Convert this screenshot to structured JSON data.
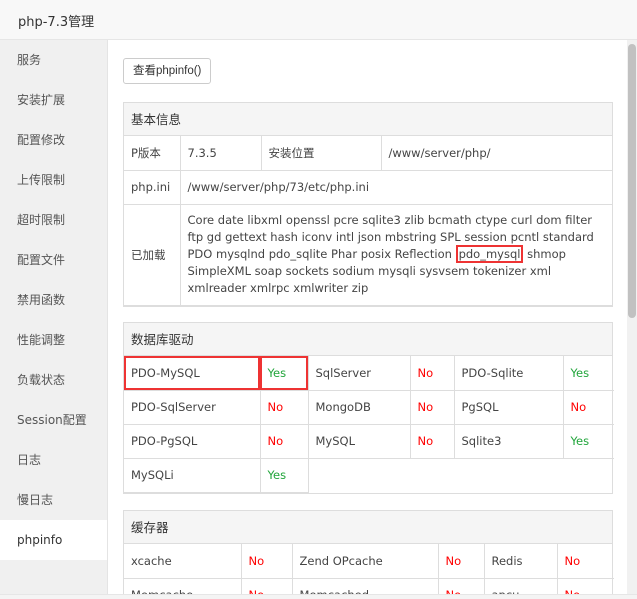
{
  "window": {
    "title": "php-7.3管理"
  },
  "sidebar": {
    "items": [
      {
        "label": "服务"
      },
      {
        "label": "安装扩展"
      },
      {
        "label": "配置修改"
      },
      {
        "label": "上传限制"
      },
      {
        "label": "超时限制"
      },
      {
        "label": "配置文件"
      },
      {
        "label": "禁用函数"
      },
      {
        "label": "性能调整"
      },
      {
        "label": "负载状态"
      },
      {
        "label": "Session配置"
      },
      {
        "label": "日志"
      },
      {
        "label": "慢日志"
      },
      {
        "label": "phpinfo",
        "active": true
      }
    ]
  },
  "main": {
    "phpinfo_button": "查看phpinfo()",
    "basic": {
      "title": "基本信息",
      "version_label": "P版本",
      "version_value": "7.3.5",
      "install_label": "安装位置",
      "install_value": "/www/server/php/",
      "ini_label": "php.ini",
      "ini_value": "/www/server/php/73/etc/php.ini",
      "loaded_label": "已加载",
      "loaded_before": "Core date libxml openssl pcre sqlite3 zlib bcmath ctype curl dom filter ftp gd gettext hash iconv intl json mbstring SPL session pcntl standard PDO mysqlnd pdo_sqlite Phar posix Reflection ",
      "loaded_mark": "pdo_mysql",
      "loaded_after": " shmop SimpleXML soap sockets sodium mysqli sysvsem tokenizer xml xmlreader xmlrpc xmlwriter zip"
    },
    "db": {
      "title": "数据库驱动",
      "rows": [
        [
          {
            "name": "PDO-MySQL",
            "status": "Yes"
          },
          {
            "name": "SqlServer",
            "status": "No"
          },
          {
            "name": "PDO-Sqlite",
            "status": "Yes"
          }
        ],
        [
          {
            "name": "PDO-SqlServer",
            "status": "No"
          },
          {
            "name": "MongoDB",
            "status": "No"
          },
          {
            "name": "PgSQL",
            "status": "No"
          }
        ],
        [
          {
            "name": "PDO-PgSQL",
            "status": "No"
          },
          {
            "name": "MySQL",
            "status": "No"
          },
          {
            "name": "Sqlite3",
            "status": "Yes"
          }
        ],
        [
          {
            "name": "MySQLi",
            "status": "Yes"
          }
        ]
      ]
    },
    "cache": {
      "title": "缓存器",
      "rows": [
        [
          {
            "name": "xcache",
            "status": "No"
          },
          {
            "name": "Zend OPcache",
            "status": "No"
          },
          {
            "name": "Redis",
            "status": "No"
          }
        ],
        [
          {
            "name": "Memcache",
            "status": "No"
          },
          {
            "name": "Memcached",
            "status": "No"
          },
          {
            "name": "apcu",
            "status": "No"
          }
        ]
      ]
    }
  },
  "colors": {
    "yes": "#20a53a",
    "no": "#ff0000",
    "highlight": "#e33333"
  }
}
